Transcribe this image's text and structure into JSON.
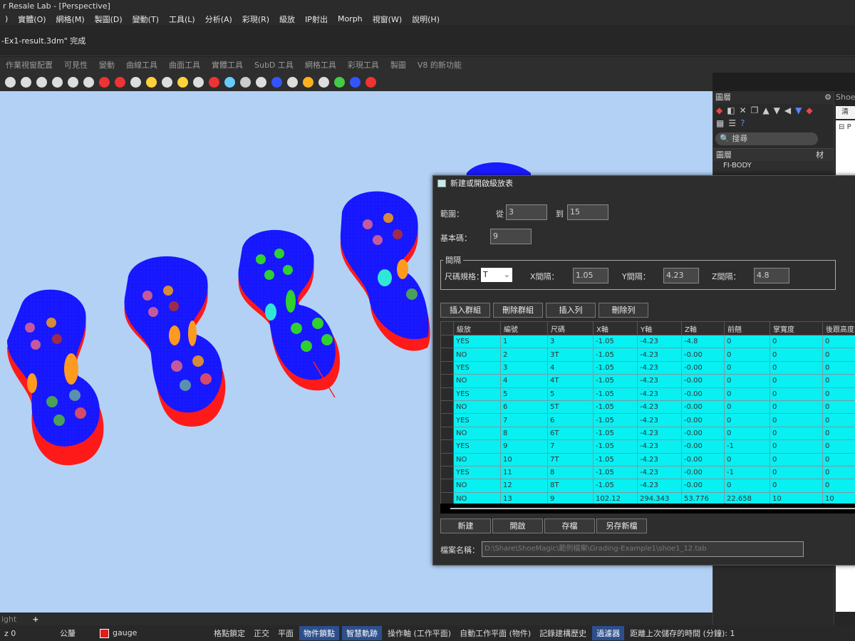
{
  "window": {
    "title": "r Resale Lab - [Perspective]"
  },
  "menu": [
    ")",
    "實體(O)",
    "網格(M)",
    "製圖(D)",
    "變動(T)",
    "工具(L)",
    "分析(A)",
    "彩現(R)",
    "級放",
    "IP射出",
    "Morph",
    "視窗(W)",
    "說明(H)"
  ],
  "command_line": "-Ex1-result.3dm\" 完成",
  "toolbar_tabs": [
    "作業視窗配置",
    "可見性",
    "變動",
    "曲線工具",
    "曲面工具",
    "實體工具",
    "SubD 工具",
    "網格工具",
    "彩現工具",
    "製圖",
    "V8 的新功能"
  ],
  "toolbar_icons": [
    "zoom-extents-icon",
    "zoom-window-icon",
    "zoom-selected-icon",
    "zoom-in-icon",
    "rotate-view-icon",
    "four-view-icon",
    "car-icon",
    "car-icon-2",
    "camera-icon",
    "render-icon",
    "lock-icon",
    "lightbulb-icon",
    "lock2-icon",
    "material-icon",
    "color-wheel-icon",
    "sphere-icon",
    "grid-icon",
    "globe-icon",
    "environment-icon",
    "settings-icon",
    "curve-icon",
    "render-preview-icon",
    "help-icon",
    "chat-icon"
  ],
  "viewport": {
    "tab_label": "ight",
    "add_tab": "+"
  },
  "status": {
    "coord": "z 0",
    "unit": "公釐",
    "layer": "gauge",
    "layer_color": "#e21b1b",
    "items": [
      {
        "label": "格點鎖定",
        "active": false
      },
      {
        "label": "正交",
        "active": false
      },
      {
        "label": "平面",
        "active": false
      },
      {
        "label": "物件鎖點",
        "active": true
      },
      {
        "label": "智慧軌跡",
        "active": true
      },
      {
        "label": "操作軸 (工作平面)",
        "active": false
      },
      {
        "label": "自動工作平面 (物件)",
        "active": false
      },
      {
        "label": "記錄建構歷史",
        "active": false
      },
      {
        "label": "過濾器",
        "active": true
      },
      {
        "label": "距離上次儲存的時間 (分鐘): 1",
        "active": false
      }
    ]
  },
  "layers_panel": {
    "title": "圖層",
    "search_placeholder": "搜尋",
    "col_layer": "圖層",
    "col_material": "材",
    "first_row": "FI-BODY",
    "first_row_color": "#e21b1b"
  },
  "side_panel": {
    "title": "ShoeM",
    "tab": "清",
    "tree_item": "P"
  },
  "dialog": {
    "title": "新建或開啟級放表",
    "range_label": "範圍：",
    "from_label": "從",
    "from_value": "3",
    "to_label": "到",
    "to_value": "15",
    "base_label": "基本碼：",
    "base_value": "9",
    "group_label": "間隔",
    "size_spec_label": "尺碼規格：",
    "size_spec_value": "T",
    "x_label": "X間隔：",
    "x_value": "1.05",
    "y_label": "Y間隔：",
    "y_value": "4.23",
    "z_label": "Z間隔：",
    "z_value": "4.8",
    "buttons_top": [
      "插入群組",
      "刪除群組",
      "插入列",
      "刪除列"
    ],
    "columns": [
      "級放",
      "編號",
      "尺碼",
      "X軸",
      "Y軸",
      "Z軸",
      "前翹",
      "掌寬度",
      "後跟高度"
    ],
    "rows": [
      [
        "YES",
        "1",
        "3",
        "-1.05",
        "-4.23",
        "-4.8",
        "0",
        "0",
        "0"
      ],
      [
        "NO",
        "2",
        "3T",
        "-1.05",
        "-4.23",
        "-0.00",
        "0",
        "0",
        "0"
      ],
      [
        "YES",
        "3",
        "4",
        "-1.05",
        "-4.23",
        "-0.00",
        "0",
        "0",
        "0"
      ],
      [
        "NO",
        "4",
        "4T",
        "-1.05",
        "-4.23",
        "-0.00",
        "0",
        "0",
        "0"
      ],
      [
        "YES",
        "5",
        "5",
        "-1.05",
        "-4.23",
        "-0.00",
        "0",
        "0",
        "0"
      ],
      [
        "NO",
        "6",
        "5T",
        "-1.05",
        "-4.23",
        "-0.00",
        "0",
        "0",
        "0"
      ],
      [
        "YES",
        "7",
        "6",
        "-1.05",
        "-4.23",
        "-0.00",
        "0",
        "0",
        "0"
      ],
      [
        "NO",
        "8",
        "6T",
        "-1.05",
        "-4.23",
        "-0.00",
        "0",
        "0",
        "0"
      ],
      [
        "YES",
        "9",
        "7",
        "-1.05",
        "-4.23",
        "-0.00",
        "-1",
        "0",
        "0"
      ],
      [
        "NO",
        "10",
        "7T",
        "-1.05",
        "-4.23",
        "-0.00",
        "0",
        "0",
        "0"
      ],
      [
        "YES",
        "11",
        "8",
        "-1.05",
        "-4.23",
        "-0.00",
        "-1",
        "0",
        "0"
      ],
      [
        "NO",
        "12",
        "8T",
        "-1.05",
        "-4.23",
        "-0.00",
        "0",
        "0",
        "0"
      ],
      [
        "NO",
        "13",
        "9",
        "102.12",
        "294.343",
        "53.776",
        "22.658",
        "10",
        "10"
      ]
    ],
    "buttons_bottom": [
      "新建",
      "開啟",
      "存檔",
      "另存新檔"
    ],
    "file_label": "檔案名稱：",
    "file_value": "D:\\Share\\ShoeMagic\\範例檔案\\Grading-Example1\\shoe1_12.tab"
  }
}
